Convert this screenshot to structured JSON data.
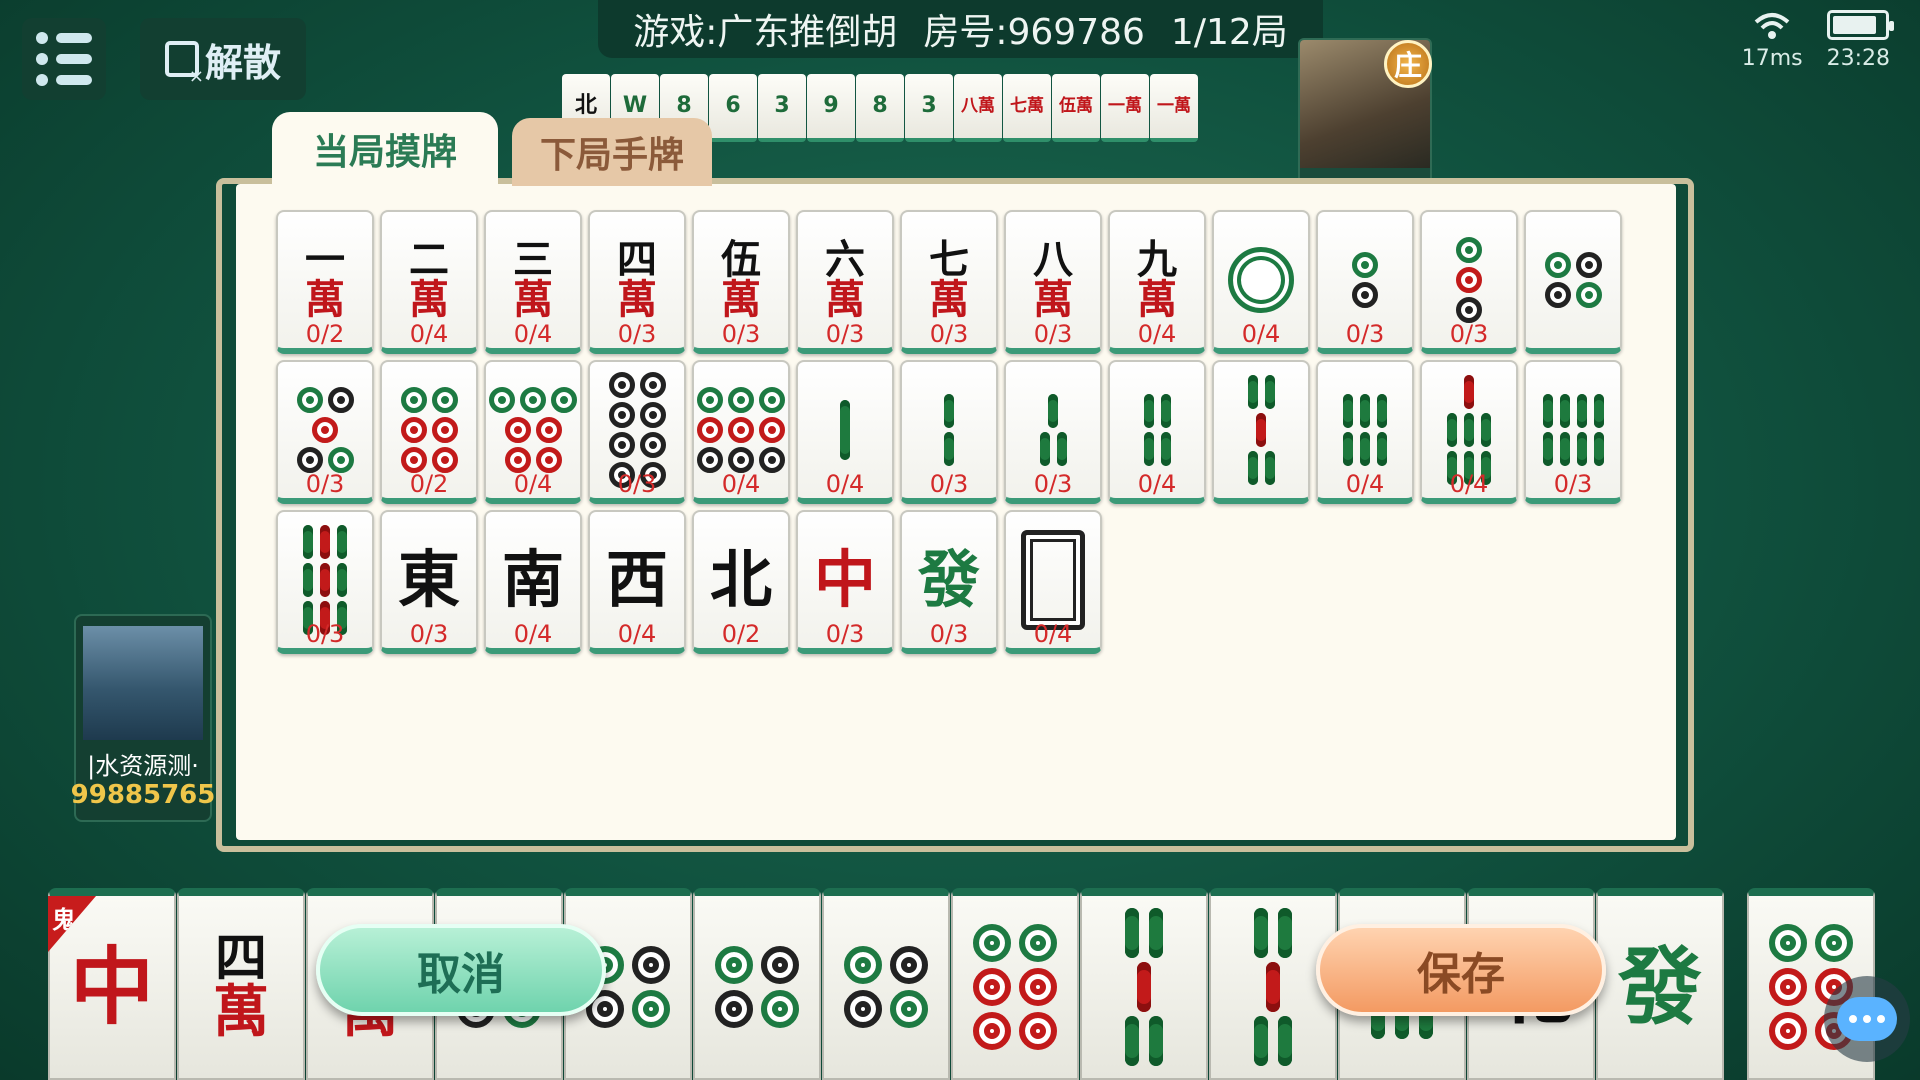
{
  "header": {
    "menu_icon": "list-icon",
    "dissolve_label": "解散",
    "game_label": "游戏:广东推倒胡",
    "room_label": "房号:969786",
    "round_label": "1/12局",
    "ping": "17ms",
    "time": "23:28",
    "battery_level": 0.85
  },
  "opponent_discards": [
    "北",
    "W",
    "8",
    "6",
    "3",
    "9",
    "8",
    "3",
    "八萬",
    "七萬",
    "伍萬",
    "一萬",
    "一萬"
  ],
  "dealer_badge": "庄",
  "left_player": {
    "name": "|水资源测·",
    "score": "99885765"
  },
  "tabs": {
    "active": "当局摸牌",
    "inactive": "下局手牌"
  },
  "tiles": [
    {
      "kind": "wan",
      "top": "一",
      "count": "0/2"
    },
    {
      "kind": "wan",
      "top": "二",
      "count": "0/4"
    },
    {
      "kind": "wan",
      "top": "三",
      "count": "0/4"
    },
    {
      "kind": "wan",
      "top": "四",
      "count": "0/3"
    },
    {
      "kind": "wan",
      "top": "伍",
      "count": "0/3"
    },
    {
      "kind": "wan",
      "top": "六",
      "count": "0/3"
    },
    {
      "kind": "wan",
      "top": "七",
      "count": "0/3"
    },
    {
      "kind": "wan",
      "top": "八",
      "count": "0/3"
    },
    {
      "kind": "wan",
      "top": "九",
      "count": "0/4"
    },
    {
      "kind": "tong",
      "n": 1,
      "count": "0/4"
    },
    {
      "kind": "tong",
      "n": 2,
      "count": "0/3"
    },
    {
      "kind": "tong",
      "n": 3,
      "count": "0/3"
    },
    {
      "kind": "tong",
      "n": 4,
      "count": ""
    },
    {
      "kind": "tong",
      "n": 5,
      "count": "0/3"
    },
    {
      "kind": "tong",
      "n": 6,
      "count": "0/2"
    },
    {
      "kind": "tong",
      "n": 7,
      "count": "0/4"
    },
    {
      "kind": "tong",
      "n": 8,
      "count": "0/3"
    },
    {
      "kind": "tong",
      "n": 9,
      "count": "0/4"
    },
    {
      "kind": "tiao",
      "n": 1,
      "count": "0/4"
    },
    {
      "kind": "tiao",
      "n": 2,
      "count": "0/3"
    },
    {
      "kind": "tiao",
      "n": 3,
      "count": "0/3"
    },
    {
      "kind": "tiao",
      "n": 4,
      "count": "0/4"
    },
    {
      "kind": "tiao",
      "n": 5,
      "count": ""
    },
    {
      "kind": "tiao",
      "n": 6,
      "count": "0/4"
    },
    {
      "kind": "tiao",
      "n": 7,
      "count": "0/4"
    },
    {
      "kind": "tiao",
      "n": 8,
      "count": "0/3"
    },
    {
      "kind": "tiao",
      "n": 9,
      "count": "0/3"
    },
    {
      "kind": "honor",
      "char": "東",
      "color": "#111",
      "count": "0/3"
    },
    {
      "kind": "honor",
      "char": "南",
      "color": "#111",
      "count": "0/4"
    },
    {
      "kind": "honor",
      "char": "西",
      "color": "#111",
      "count": "0/4"
    },
    {
      "kind": "honor",
      "char": "北",
      "color": "#111",
      "count": "0/2"
    },
    {
      "kind": "honor",
      "char": "中",
      "color": "#c0161b",
      "count": "0/3"
    },
    {
      "kind": "honor",
      "char": "發",
      "color": "#1d7a42",
      "count": "0/3"
    },
    {
      "kind": "white",
      "count": "0/4"
    }
  ],
  "hand": [
    {
      "kind": "honor",
      "char": "中",
      "color": "#c0161b",
      "ghost": "鬼"
    },
    {
      "kind": "wan",
      "top": "四"
    },
    {
      "kind": "wan",
      "top": "七"
    },
    {
      "kind": "tong",
      "n": 4
    },
    {
      "kind": "tong",
      "n": 4
    },
    {
      "kind": "tong",
      "n": 4
    },
    {
      "kind": "tong",
      "n": 4
    },
    {
      "kind": "tong",
      "n": 6
    },
    {
      "kind": "tiao",
      "n": 5
    },
    {
      "kind": "tiao",
      "n": 5
    },
    {
      "kind": "tiao",
      "n": 6
    },
    {
      "kind": "honor",
      "char": "北",
      "color": "#111"
    },
    {
      "kind": "honor",
      "char": "發",
      "color": "#1d7a42"
    },
    {
      "kind": "tong",
      "n": 6
    }
  ],
  "buttons": {
    "cancel": "取消",
    "save": "保存"
  },
  "colors": {
    "table_green": "#10513e",
    "tile_edge": "#3b9a78",
    "count_red": "#d42a2a",
    "score_gold": "#f0c64a"
  }
}
